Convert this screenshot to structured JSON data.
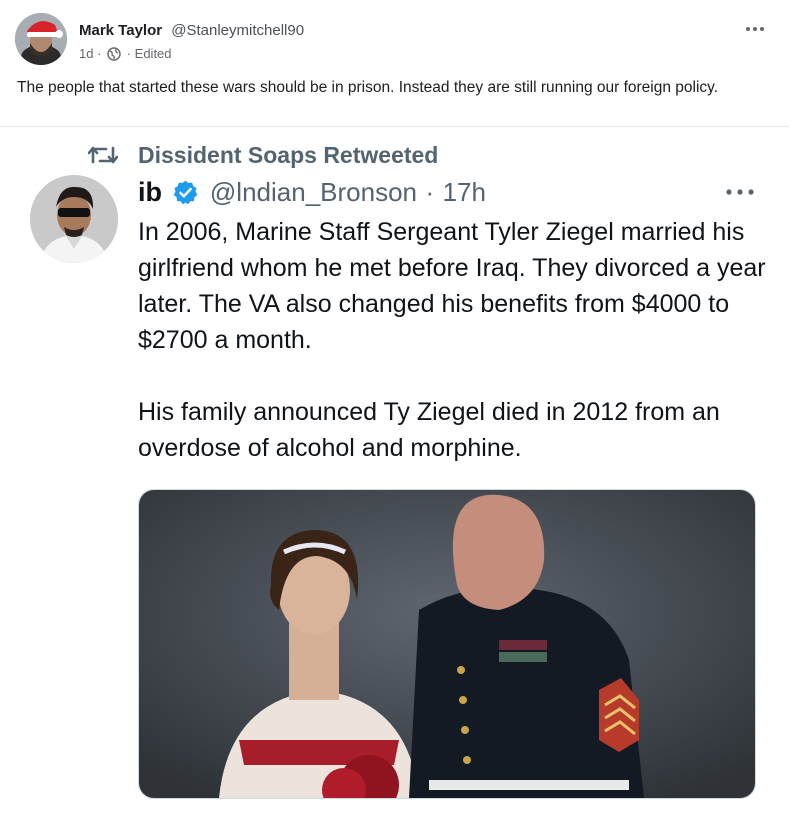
{
  "post": {
    "author_name": "Mark Taylor",
    "author_handle": "@Stanleymitchell90",
    "time": "1d",
    "edited_label": "Edited",
    "text": "The people that started these wars should be in prison. Instead they are still running our foreign policy."
  },
  "tweet": {
    "retweet_label": "Dissident Soaps Retweeted",
    "name": "ib",
    "handle": "@lndian_Bronson",
    "separator": "·",
    "time": "17h",
    "paragraphs": [
      "In 2006, Marine Staff Sergeant Tyler Ziegel married his girlfriend whom he met before Iraq. They divorced a year later. The VA also changed his benefits from $4000 to $2700 a month.",
      "His family announced Ty Ziegel died in 2012 from an overdose of alcohol and morphine."
    ]
  },
  "colors": {
    "text_primary": "#1c1e21",
    "text_secondary": "#65676b",
    "tweet_gray": "#536471",
    "verified_blue": "#1d9bf0"
  },
  "icons": [
    "more-icon",
    "globe-icon",
    "retweet-icon",
    "verified-badge-icon"
  ]
}
